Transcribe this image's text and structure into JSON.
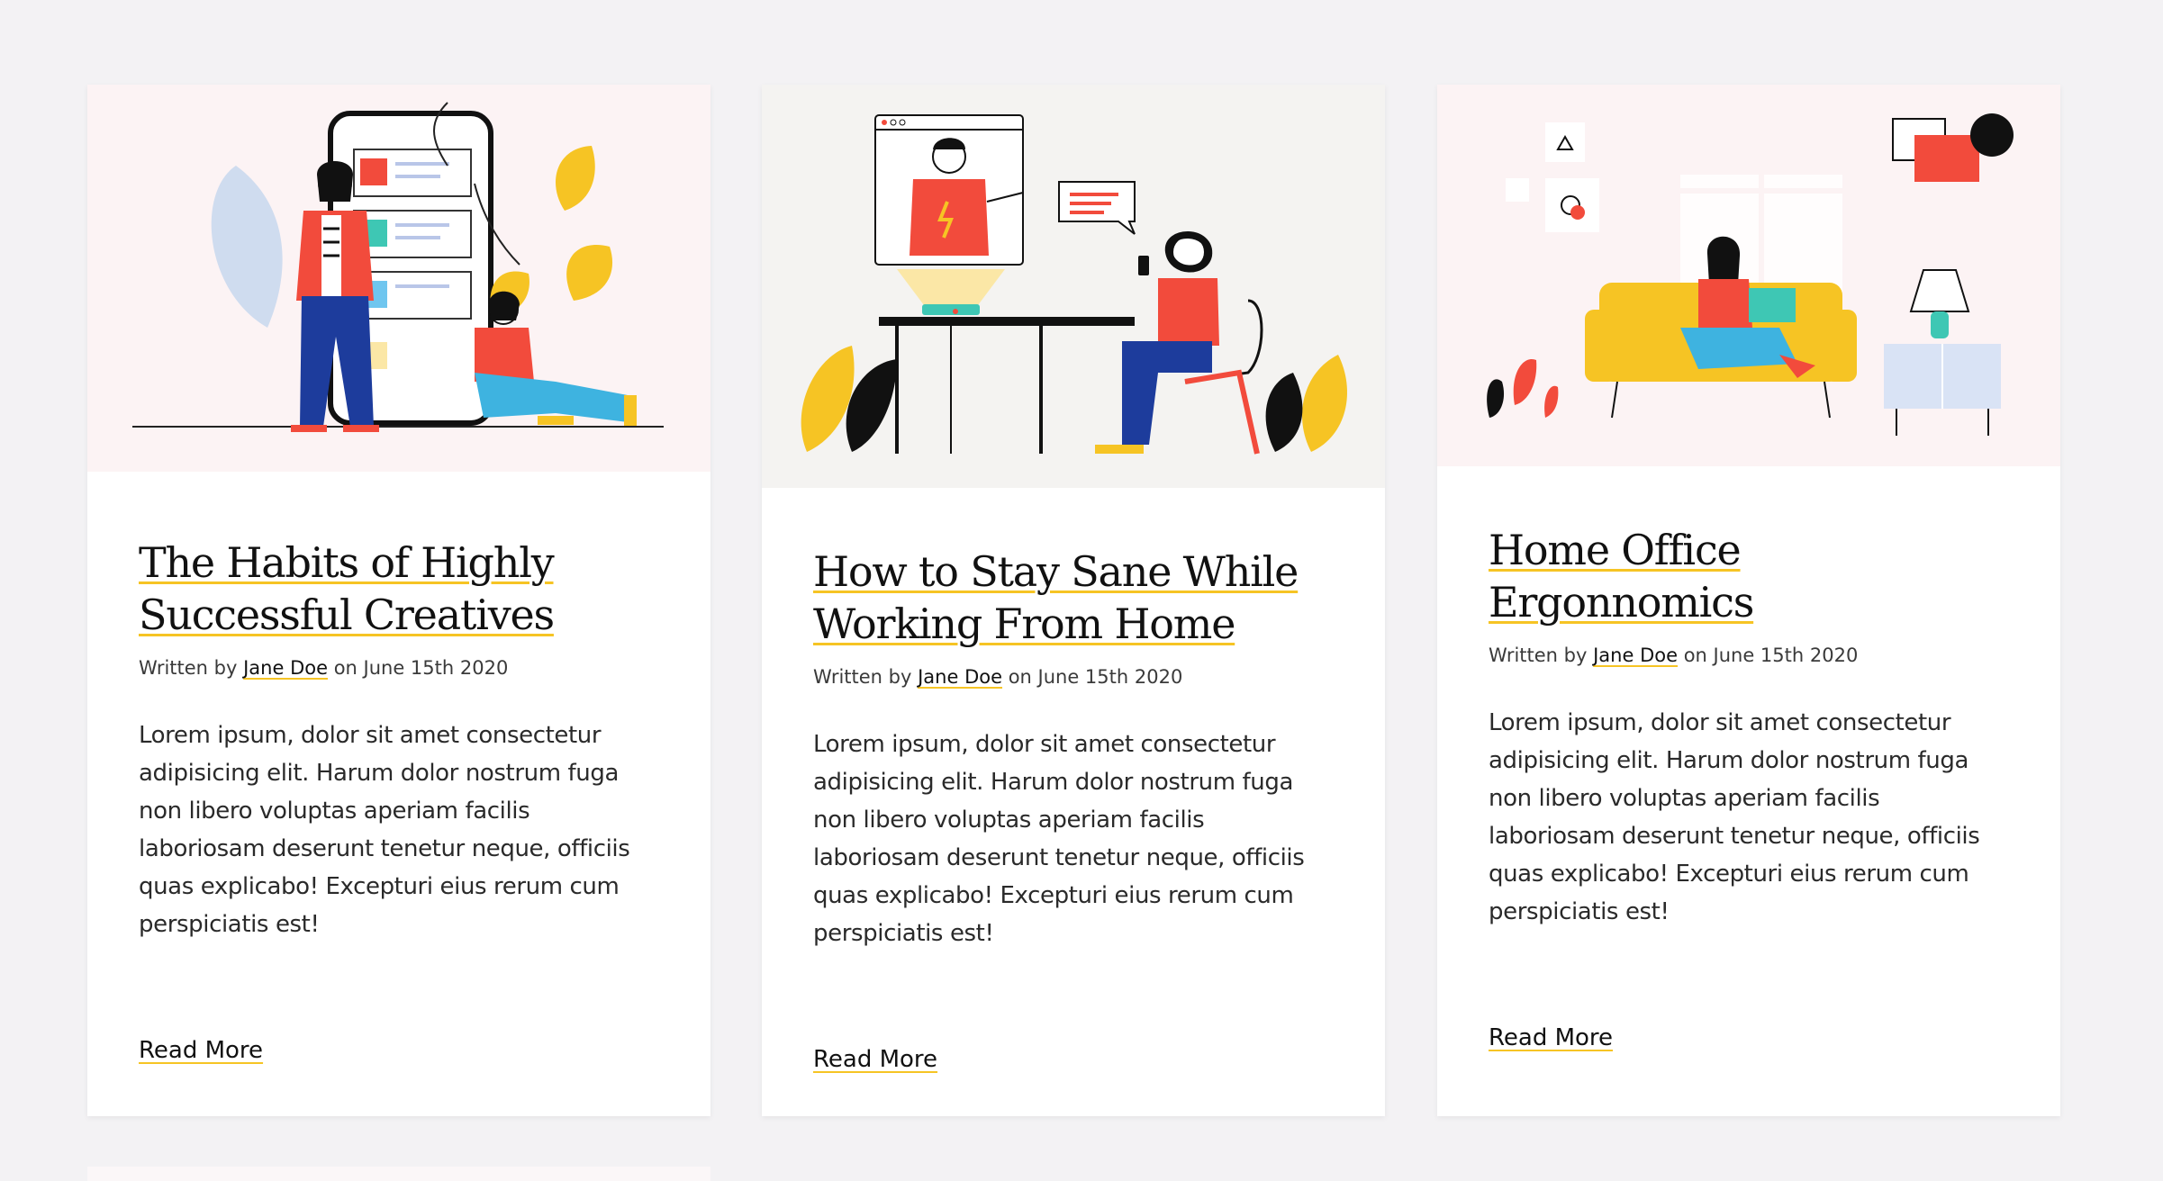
{
  "cards": [
    {
      "title": "The Habits of Highly Successful Creatives",
      "meta_prefix": "Written by ",
      "author": "Jane Doe",
      "meta_suffix": " on June 15th 2020",
      "excerpt": "Lorem ipsum, dolor sit amet consectetur adipisicing elit. Harum dolor nostrum fuga non libero voluptas aperiam facilis laboriosam deserunt tenetur neque, officiis quas explicabo! Excepturi eius rerum cum perspiciatis est!",
      "read_more": "Read More",
      "illustration": "person-with-phone-illustration"
    },
    {
      "title": "How to Stay Sane While Working From Home",
      "meta_prefix": "Written by ",
      "author": "Jane Doe",
      "meta_suffix": " on June 15th 2020",
      "excerpt": "Lorem ipsum, dolor sit amet consectetur adipisicing elit. Harum dolor nostrum fuga non libero voluptas aperiam facilis laboriosam deserunt tenetur neque, officiis quas explicabo! Excepturi eius rerum cum perspiciatis est!",
      "read_more": "Read More",
      "illustration": "video-call-illustration"
    },
    {
      "title": "Home Office Ergonnomics",
      "meta_prefix": "Written by ",
      "author": "Jane Doe",
      "meta_suffix": " on June 15th 2020",
      "excerpt": "Lorem ipsum, dolor sit amet consectetur adipisicing elit. Harum dolor nostrum fuga non libero voluptas aperiam facilis laboriosam deserunt tenetur neque, officiis quas explicabo! Excepturi eius rerum cum perspiciatis est!",
      "read_more": "Read More",
      "illustration": "sofa-laptop-illustration"
    }
  ],
  "colors": {
    "page_background": "#f3f2f4",
    "card_background": "#ffffff",
    "accent_underline": "#f6c424",
    "text": "#111111"
  }
}
